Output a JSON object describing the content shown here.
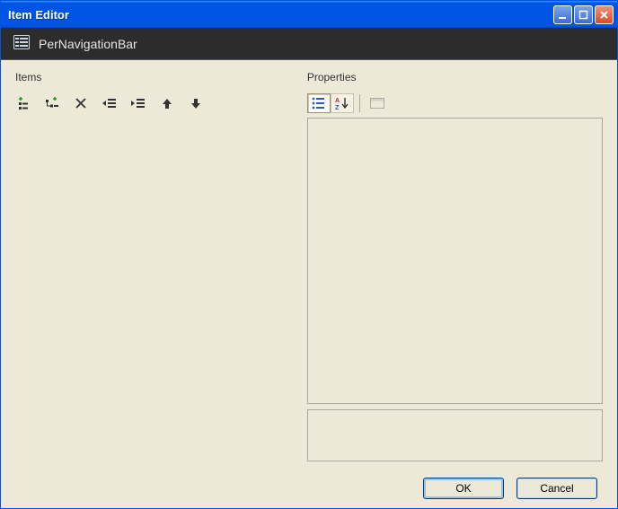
{
  "window": {
    "title": "Item Editor"
  },
  "header": {
    "label": "PerNavigationBar"
  },
  "left": {
    "title": "Items"
  },
  "right": {
    "title": "Properties"
  },
  "buttons": {
    "ok": "OK",
    "cancel": "Cancel"
  }
}
